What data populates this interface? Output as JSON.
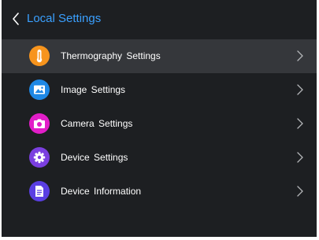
{
  "header": {
    "title": "Local Settings",
    "back_icon": "chevron-left-icon"
  },
  "menu": {
    "items": [
      {
        "label": "Thermography  Settings",
        "icon": "thermometer-icon",
        "icon_color": "#f7941d",
        "selected": true
      },
      {
        "label": "Image  Settings",
        "icon": "image-icon",
        "icon_color": "#1e88e5",
        "selected": false
      },
      {
        "label": "Camera  Settings",
        "icon": "camera-icon",
        "icon_color": "#e21ec8",
        "selected": false
      },
      {
        "label": "Device  Settings",
        "icon": "gear-icon",
        "icon_color": "#7b3fe0",
        "selected": false
      },
      {
        "label": "Device Information",
        "icon": "document-icon",
        "icon_color": "#5a3fe3",
        "selected": false
      }
    ]
  },
  "colors": {
    "background": "#1d1f22",
    "selected_row": "#35373b",
    "accent": "#3aa0ff",
    "text": "#ffffff",
    "chevron": "#b5b7ba"
  }
}
